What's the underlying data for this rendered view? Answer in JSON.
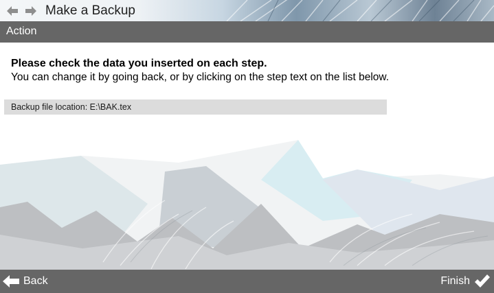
{
  "titlebar": {
    "title": "Make a Backup",
    "back_icon": "arrow-left-icon",
    "forward_icon": "arrow-right-icon"
  },
  "action_bar": {
    "label": "Action"
  },
  "main": {
    "heading": "Please check the data you inserted on each step.",
    "subtext": "You can change it by going back, or by clicking on the step text on the list below.",
    "summary": [
      {
        "text": "Backup file location: E:\\BAK.tex"
      }
    ]
  },
  "footer": {
    "back_label": "Back",
    "back_icon": "arrow-left-icon",
    "finish_label": "Finish",
    "finish_icon": "checkmark-icon"
  },
  "colors": {
    "bar": "#666666",
    "summary_row": "#dcdcdc",
    "text_light": "#ffffff"
  }
}
